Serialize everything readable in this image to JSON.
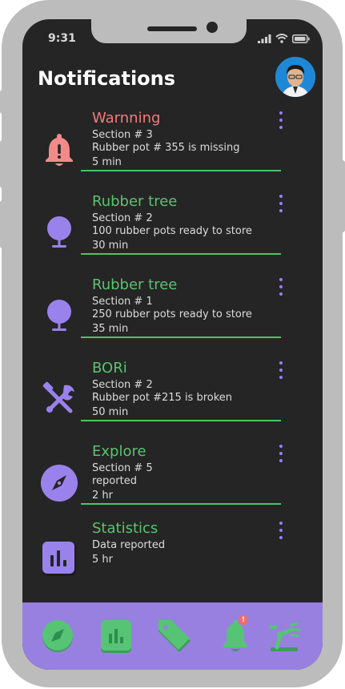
{
  "status_bar": {
    "time": "9:31"
  },
  "header": {
    "title": "Notifications"
  },
  "colors": {
    "accent_purple": "#9880e0",
    "heading_green": "#59c46e",
    "heading_warning": "#f27b7b",
    "divider_green": "#4cc464"
  },
  "notifications": [
    {
      "icon": "bell-alert-icon",
      "title": "Warnning",
      "line1": "Section # 3",
      "line2": "Rubber pot # 355 is missing",
      "time": "5 min"
    },
    {
      "icon": "tree-icon",
      "title": "Rubber tree",
      "line1": "Section # 2",
      "line2": "100 rubber pots ready to store",
      "time": "30 min"
    },
    {
      "icon": "tree-icon",
      "title": "Rubber tree",
      "line1": "Section # 1",
      "line2": "250 rubber pots ready to store",
      "time": "35 min"
    },
    {
      "icon": "tools-icon",
      "title": "BORi",
      "line1": "Section # 2",
      "line2": "Rubber pot #215 is broken",
      "time": "50 min"
    },
    {
      "icon": "compass-icon",
      "title": "Explore",
      "line1": "Section # 5",
      "line2": "reported",
      "time": "2 hr"
    },
    {
      "icon": "statistics-icon",
      "title": "Statistics",
      "line1": "Data reported",
      "line2": "5 hr",
      "time": ""
    }
  ],
  "tabbar": [
    {
      "icon": "compass-icon"
    },
    {
      "icon": "statistics-icon"
    },
    {
      "icon": "tag-icon"
    },
    {
      "icon": "bell-icon",
      "badge": "!"
    },
    {
      "icon": "robot-arm-icon"
    }
  ]
}
